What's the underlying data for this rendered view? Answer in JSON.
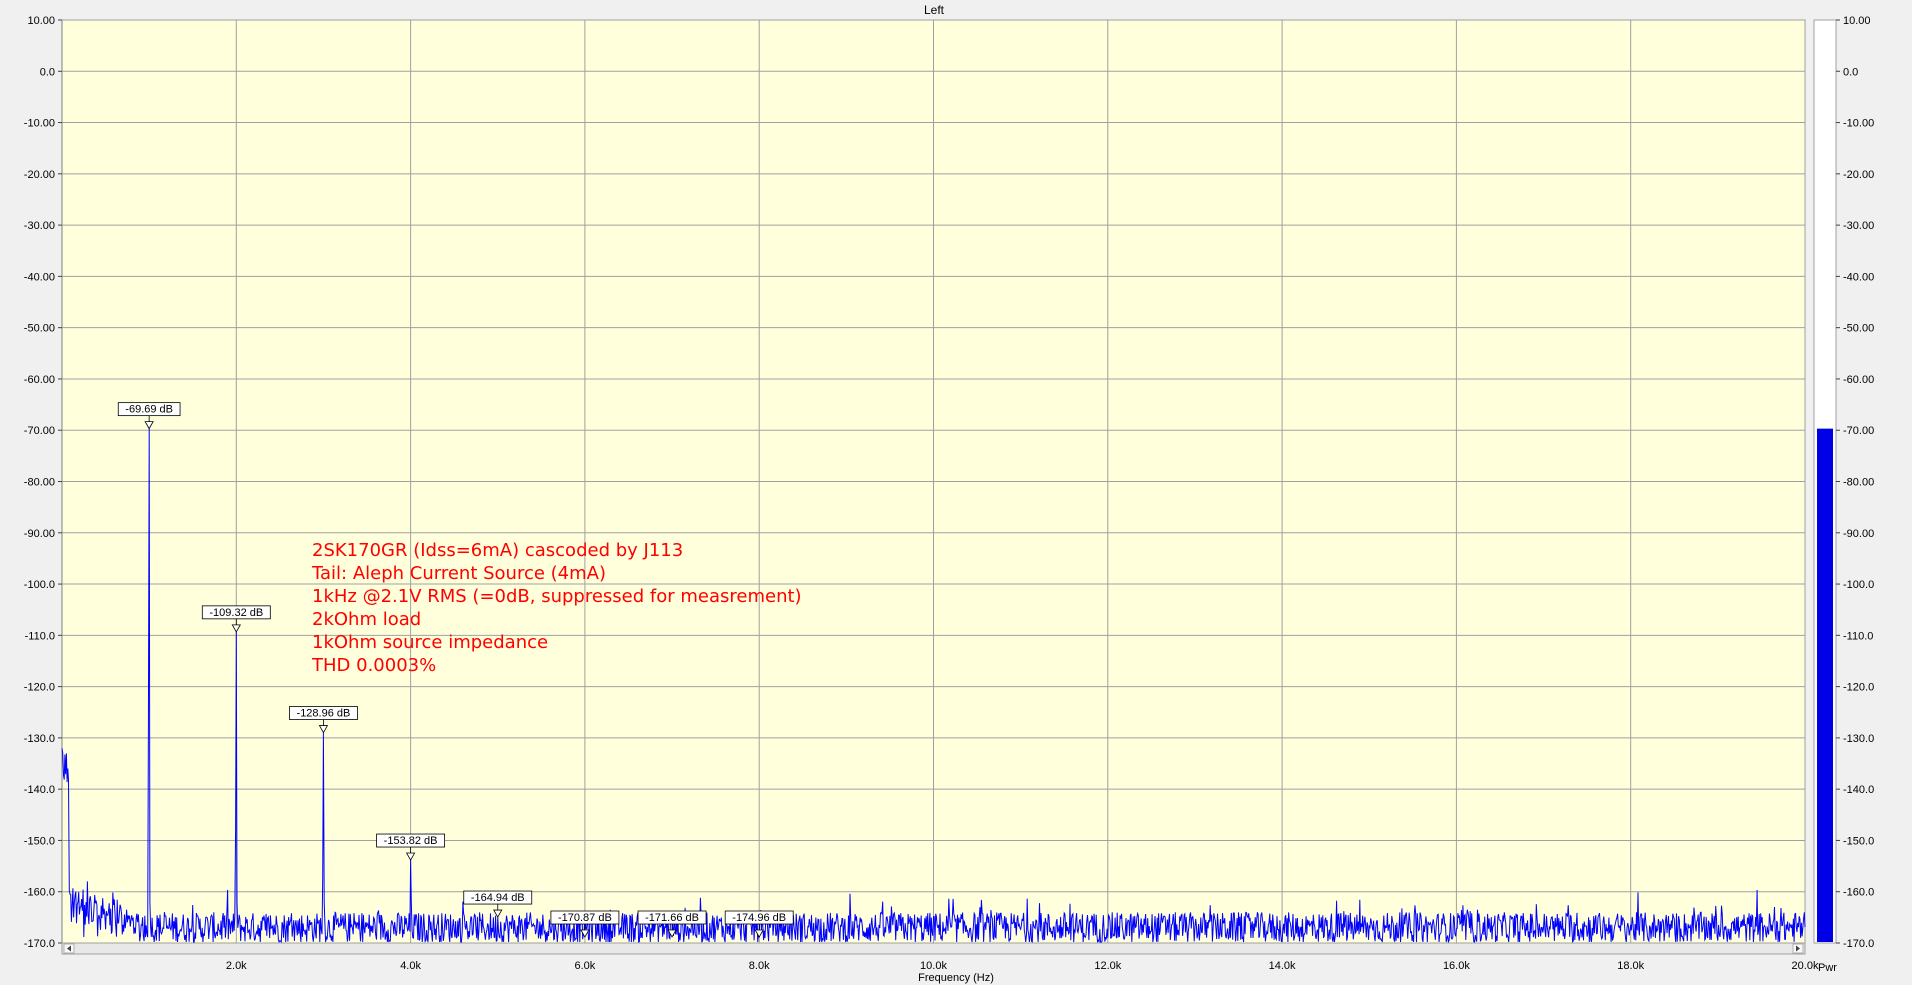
{
  "chart_data": {
    "type": "line",
    "title": "Left",
    "xlabel": "Frequency (Hz)",
    "ylabel": "",
    "xlim": [
      0,
      20000
    ],
    "ylim": [
      -170,
      10
    ],
    "grid": true,
    "x_ticks": [
      2000,
      4000,
      6000,
      8000,
      10000,
      12000,
      14000,
      16000,
      18000,
      20000
    ],
    "x_tick_labels": [
      "2.0k",
      "4.0k",
      "6.0k",
      "8.0k",
      "10.0k",
      "12.0k",
      "14.0k",
      "16.0k",
      "18.0k",
      "20.0k"
    ],
    "y_ticks": [
      10,
      0,
      -10,
      -20,
      -30,
      -40,
      -50,
      -60,
      -70,
      -80,
      -90,
      -100,
      -110,
      -120,
      -130,
      -140,
      -150,
      -160,
      -170
    ],
    "y_tick_labels": [
      "10.00",
      "0.0",
      "-10.00",
      "-20.00",
      "-30.00",
      "-40.00",
      "-50.00",
      "-60.00",
      "-70.00",
      "-80.00",
      "-90.00",
      "-100.0",
      "-110.0",
      "-120.0",
      "-130.0",
      "-140.0",
      "-150.0",
      "-160.0",
      "-170.0"
    ],
    "noise_floor_db": -166,
    "peaks": [
      {
        "x": 1000,
        "y": -69.69,
        "label": "-69.69 dB"
      },
      {
        "x": 2000,
        "y": -109.32,
        "label": "-109.32 dB"
      },
      {
        "x": 3000,
        "y": -128.96,
        "label": "-128.96 dB"
      },
      {
        "x": 4000,
        "y": -153.82,
        "label": "-153.82 dB"
      },
      {
        "x": 5000,
        "y": -164.94,
        "label": "-164.94 dB"
      },
      {
        "x": 6000,
        "y": -170.87,
        "label": "-170.87 dB"
      },
      {
        "x": 7000,
        "y": -171.66,
        "label": "-171.66 dB"
      },
      {
        "x": 8000,
        "y": -174.96,
        "label": "-174.96 dB"
      }
    ],
    "annotation_lines": [
      "2SK170GR (Idss=6mA) cascoded by J113",
      "Tail: Aleph Current Source (4mA)",
      "1kHz @2.1V RMS (=0dB, suppressed for measrement)",
      "2kOhm load",
      "1kOhm source impedance",
      "THD 0.0003%"
    ],
    "level_meter": {
      "label": "Pwr",
      "value_db": -69.69
    },
    "colors": {
      "plot_bg": "#ffffdc",
      "trace": "#0000ff",
      "grid": "#a0a0a0",
      "annotation": "#ff0000",
      "meter": "#0000e6"
    }
  }
}
